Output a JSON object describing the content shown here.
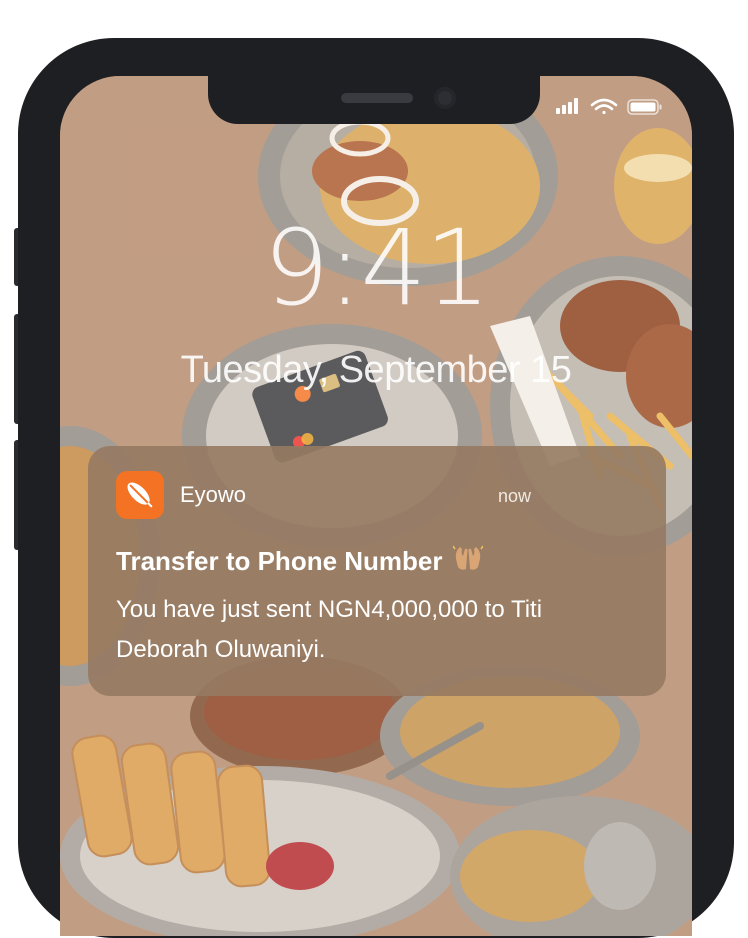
{
  "lock_screen": {
    "time": "9:41",
    "date": "Tuesday, September 15"
  },
  "status_bar": {
    "icons": [
      "cellular-signal-icon",
      "wifi-icon",
      "battery-icon"
    ]
  },
  "notification": {
    "app_name": "Eyowo",
    "app_icon": "eyowo-feather-icon",
    "app_color": "#f37224",
    "time": "now",
    "title": "Transfer to Phone Number",
    "title_emoji": "raising-hands-icon",
    "body": "You have just sent NGN4,000,000 to Titi Deborah Oluwaniyi."
  }
}
